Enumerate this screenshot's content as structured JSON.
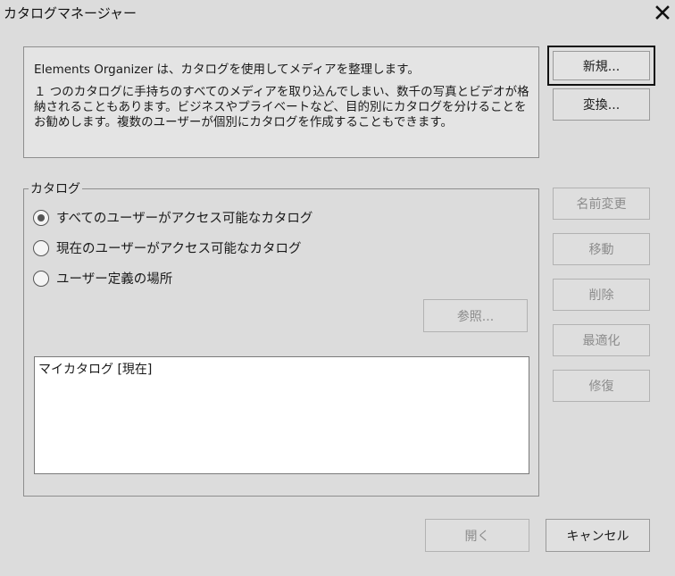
{
  "window": {
    "title": "カタログマネージャー",
    "close_icon": "close-icon"
  },
  "info": {
    "line1": "Elements Organizer は、カタログを使用してメディアを整理します。",
    "paragraph": "１ つのカタログに手持ちのすべてのメディアを取り込んでしまい、数千の写真とビデオが格納されることもあります。ビジネスやプライベートなど、目的別にカタログを分けることをお勧めします。複数のユーザーが個別にカタログを作成することもできます。"
  },
  "buttons": {
    "new": "新規...",
    "convert": "変換...",
    "rename": "名前変更",
    "move": "移動",
    "delete": "削除",
    "optimize": "最適化",
    "repair": "修復",
    "browse": "参照...",
    "open": "開く",
    "cancel": "キャンセル"
  },
  "catalog_group": {
    "label": "カタログ",
    "radios": [
      {
        "label": "すべてのユーザーがアクセス可能なカタログ",
        "checked": true
      },
      {
        "label": "現在のユーザーがアクセス可能なカタログ",
        "checked": false
      },
      {
        "label": "ユーザー定義の場所",
        "checked": false
      }
    ],
    "list_items": [
      "マイカタログ [現在]"
    ]
  }
}
